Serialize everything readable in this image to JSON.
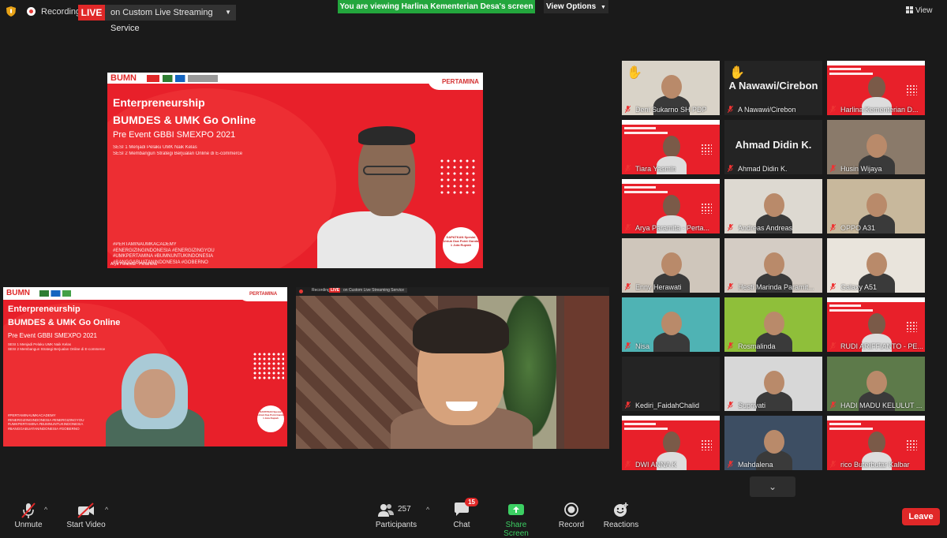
{
  "topbar": {
    "recording_label": "Recording",
    "live_badge": "LIVE",
    "live_service": "on Custom Live Streaming Service",
    "viewing_banner": "You are viewing Harlina Kementerian Desa's screen",
    "view_options": "View Options",
    "view_label": "View"
  },
  "main_slide": {
    "logo": "BUMN",
    "brand": "PERTAMINA",
    "title_line1": "Enterpreneurship",
    "title_line2": "BUMDES & UMK Go Online",
    "subtitle": "Pre Event GBBI SMEXPO 2021",
    "sesi1": "SESI 1 Menjadi Pelaku UMK Naik Kelas",
    "sesi2": "SESI 2 Membangun Strategi Berjualan Online di E-commerce",
    "hashtags": "#PERTAMINAUMKACADEMY\n#ENERGIZINGINDONESIA #ENERGIZINGYOU\n#UMKPERTAMINA #BUMNUNTUKINDONESIA\n#BANGGABUATANINDONESIA #GOBERNO",
    "seal_text": "DAPATKAN Spesial Untuk Dua Point Ganda 1 Juta Rupiah",
    "caption": "Arya Paramita - Pertamina"
  },
  "left_slide": {
    "logo": "BUMN",
    "brand": "PERTAMINA",
    "title_line1": "Enterpreneurship",
    "title_line2": "BUMDES & UMK Go Online",
    "subtitle": "Pre Event GBBI SMEXPO 2021",
    "sesi1": "SESI 1 Menjadi Pelaku UMK Naik Kelas",
    "sesi2": "SESI 2 Membangun Strategi Berjualan Online di E-commerce",
    "hashtags": "#PERTAMINAUMKACADEMY\n#ENERGIZINGINDONESIA #ENERGIZINGYOU\n#UMKPERTAMINA #BUMNUNTUKINDONESIA\n#BANGGABUATANINDONESIA #GOBERNO",
    "seal_text": "DAPATKAN Spesial Untuk Dua Point Ganda 1 Juta Rupiah"
  },
  "center_video": {
    "mini_recording": "Recording",
    "mini_live": "LIVE",
    "mini_service": "on Custom Live Streaming Service"
  },
  "participants": [
    {
      "name": "Deni Sukarno SH PDP",
      "hand": true,
      "kind": "video",
      "bg": "#d9d3c8"
    },
    {
      "name": "A Nawawi/Cirebon",
      "hand": true,
      "kind": "text",
      "display": "A Nawawi/Cirebon"
    },
    {
      "name": "Harlina Kementerian D...",
      "kind": "slide",
      "active": true
    },
    {
      "name": "Tiara Yasmin",
      "kind": "slide"
    },
    {
      "name": "Ahmad Didin K.",
      "kind": "text",
      "display": "Ahmad Didin K."
    },
    {
      "name": "Husin Wijaya",
      "kind": "video",
      "bg": "#8a7a6a"
    },
    {
      "name": "Arya Paramita - Perta...",
      "kind": "slide"
    },
    {
      "name": "Andreas Andreas",
      "kind": "video",
      "bg": "#ddd9d1"
    },
    {
      "name": "OPPO A31",
      "kind": "video",
      "bg": "#c8b89c"
    },
    {
      "name": "Enny Herawati",
      "kind": "video",
      "bg": "#cfc6bb"
    },
    {
      "name": "Hesti Marinda Paramit...",
      "kind": "video",
      "bg": "#d4ccc4"
    },
    {
      "name": "Galaxy A51",
      "kind": "video",
      "bg": "#e9e4dc"
    },
    {
      "name": "Nisa",
      "kind": "video",
      "bg": "#4fb3b4"
    },
    {
      "name": "Rosmalinda",
      "kind": "video",
      "bg": "#8fbf3a"
    },
    {
      "name": "RUDI ARIFFIANTO - PE...",
      "kind": "slide"
    },
    {
      "name": "Kediri_FaidahChalid",
      "kind": "blank"
    },
    {
      "name": "Supriyati",
      "kind": "video",
      "bg": "#d7d7d7"
    },
    {
      "name": "HADI MADU KELULUT ...",
      "kind": "video",
      "bg": "#5d7a4a"
    },
    {
      "name": "DWI ANNA K",
      "kind": "slide"
    },
    {
      "name": "Mahdalena",
      "kind": "video",
      "bg": "#3d4e63"
    },
    {
      "name": "rico Buterbutar Kalbar",
      "kind": "slide"
    }
  ],
  "toolbar": {
    "unmute": "Unmute",
    "start_video": "Start Video",
    "participants_label": "Participants",
    "participants_count": "257",
    "chat": "Chat",
    "chat_badge": "15",
    "share_screen": "Share Screen",
    "record": "Record",
    "reactions": "Reactions",
    "leave": "Leave"
  },
  "colors": {
    "accent_red": "#e02828",
    "share_green": "#3ccf63",
    "banner_green": "#23a63d",
    "active_speaker": "#f5e663"
  }
}
